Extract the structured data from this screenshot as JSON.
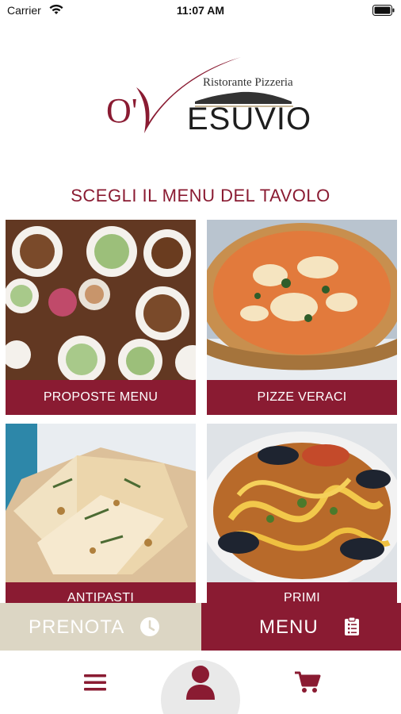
{
  "status_bar": {
    "carrier": "Carrier",
    "time": "11:07 AM",
    "icons": [
      "wifi-icon",
      "battery-icon"
    ]
  },
  "logo": {
    "letter_o": "O'",
    "tagline": "Ristorante Pizzeria",
    "name": "ESUVIO"
  },
  "section_title": "SCEGLI IL MENU DEL TAVOLO",
  "menu_tiles": [
    {
      "label": "PROPOSTE MENU",
      "image": "food-table-photo"
    },
    {
      "label": "PIZZE VERACI",
      "image": "pizza-photo"
    },
    {
      "label": "ANTIPASTI",
      "image": "focaccia-photo"
    },
    {
      "label": "PRIMI",
      "image": "seafood-pasta-photo"
    }
  ],
  "action_bar": {
    "prenota_label": "PRENOTA",
    "prenota_icon": "clock-icon",
    "menu_label": "MENU",
    "menu_icon": "clipboard-icon"
  },
  "bottom_nav": {
    "items": [
      {
        "icon": "hamburger-menu-icon"
      },
      {
        "icon": "user-icon"
      },
      {
        "icon": "cart-icon"
      }
    ]
  },
  "colors": {
    "brand": "#8a1b32",
    "beige": "#dcd6c4",
    "nav_bg": "#e9e9e9"
  }
}
